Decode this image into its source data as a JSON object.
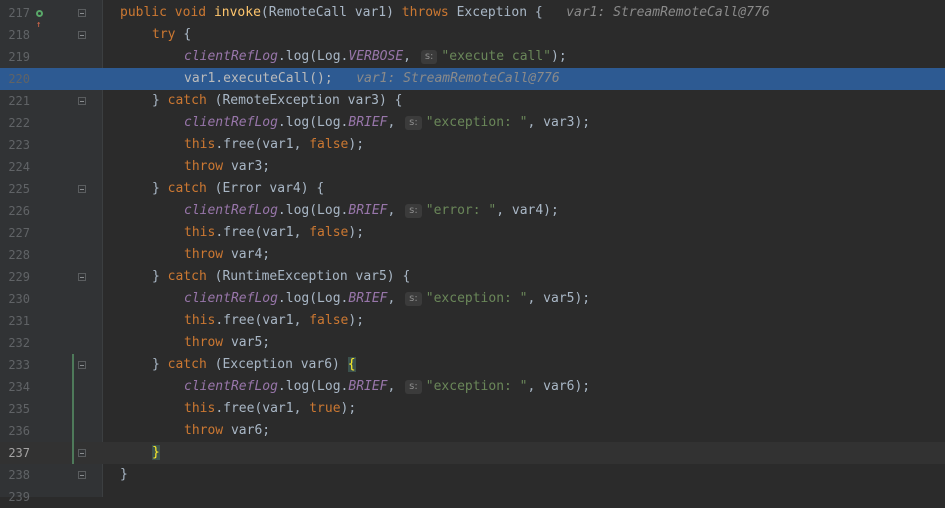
{
  "editor": {
    "lines": [
      {
        "num": "217",
        "tokens": [
          {
            "t": "public ",
            "c": "kw"
          },
          {
            "t": "void ",
            "c": "kw"
          },
          {
            "t": "invoke",
            "c": "fn"
          },
          {
            "t": "(RemoteCall var1) ",
            "c": "plain"
          },
          {
            "t": "throws ",
            "c": "kw"
          },
          {
            "t": "Exception {",
            "c": "plain"
          },
          {
            "t": "   var1: StreamRemoteCall@776",
            "c": "cmt"
          }
        ],
        "indent": 0
      },
      {
        "num": "218",
        "tokens": [
          {
            "t": "try ",
            "c": "kw"
          },
          {
            "t": "{",
            "c": "plain"
          }
        ],
        "indent": 1
      },
      {
        "num": "219",
        "tokens": [
          {
            "t": "clientRefLog",
            "c": "fld"
          },
          {
            "t": ".log(Log.",
            "c": "plain"
          },
          {
            "t": "VERBOSE",
            "c": "fld"
          },
          {
            "t": ", ",
            "c": "plain"
          },
          {
            "hint": "s:"
          },
          {
            "t": "\"execute call\"",
            "c": "str"
          },
          {
            "t": ");",
            "c": "plain"
          }
        ],
        "indent": 2
      },
      {
        "num": "220",
        "tokens": [
          {
            "t": "var1.executeCall();",
            "c": "plain"
          },
          {
            "t": "   var1: StreamRemoteCall@776",
            "c": "cmt"
          }
        ],
        "indent": 2,
        "exec": true
      },
      {
        "num": "221",
        "tokens": [
          {
            "t": "} ",
            "c": "plain"
          },
          {
            "t": "catch ",
            "c": "kw"
          },
          {
            "t": "(RemoteException var3) {",
            "c": "plain"
          }
        ],
        "indent": 1
      },
      {
        "num": "222",
        "tokens": [
          {
            "t": "clientRefLog",
            "c": "fld"
          },
          {
            "t": ".log(Log.",
            "c": "plain"
          },
          {
            "t": "BRIEF",
            "c": "fld"
          },
          {
            "t": ", ",
            "c": "plain"
          },
          {
            "hint": "s:"
          },
          {
            "t": "\"exception: \"",
            "c": "str"
          },
          {
            "t": ", var3);",
            "c": "plain"
          }
        ],
        "indent": 2
      },
      {
        "num": "223",
        "tokens": [
          {
            "t": "this",
            "c": "kw"
          },
          {
            "t": ".free(var1, ",
            "c": "plain"
          },
          {
            "t": "false",
            "c": "kw"
          },
          {
            "t": ");",
            "c": "plain"
          }
        ],
        "indent": 2
      },
      {
        "num": "224",
        "tokens": [
          {
            "t": "throw ",
            "c": "kw"
          },
          {
            "t": "var3;",
            "c": "plain"
          }
        ],
        "indent": 2
      },
      {
        "num": "225",
        "tokens": [
          {
            "t": "} ",
            "c": "plain"
          },
          {
            "t": "catch ",
            "c": "kw"
          },
          {
            "t": "(Error var4) {",
            "c": "plain"
          }
        ],
        "indent": 1
      },
      {
        "num": "226",
        "tokens": [
          {
            "t": "clientRefLog",
            "c": "fld"
          },
          {
            "t": ".log(Log.",
            "c": "plain"
          },
          {
            "t": "BRIEF",
            "c": "fld"
          },
          {
            "t": ", ",
            "c": "plain"
          },
          {
            "hint": "s:"
          },
          {
            "t": "\"error: \"",
            "c": "str"
          },
          {
            "t": ", var4);",
            "c": "plain"
          }
        ],
        "indent": 2
      },
      {
        "num": "227",
        "tokens": [
          {
            "t": "this",
            "c": "kw"
          },
          {
            "t": ".free(var1, ",
            "c": "plain"
          },
          {
            "t": "false",
            "c": "kw"
          },
          {
            "t": ");",
            "c": "plain"
          }
        ],
        "indent": 2
      },
      {
        "num": "228",
        "tokens": [
          {
            "t": "throw ",
            "c": "kw"
          },
          {
            "t": "var4;",
            "c": "plain"
          }
        ],
        "indent": 2
      },
      {
        "num": "229",
        "tokens": [
          {
            "t": "} ",
            "c": "plain"
          },
          {
            "t": "catch ",
            "c": "kw"
          },
          {
            "t": "(RuntimeException var5) {",
            "c": "plain"
          }
        ],
        "indent": 1
      },
      {
        "num": "230",
        "tokens": [
          {
            "t": "clientRefLog",
            "c": "fld"
          },
          {
            "t": ".log(Log.",
            "c": "plain"
          },
          {
            "t": "BRIEF",
            "c": "fld"
          },
          {
            "t": ", ",
            "c": "plain"
          },
          {
            "hint": "s:"
          },
          {
            "t": "\"exception: \"",
            "c": "str"
          },
          {
            "t": ", var5);",
            "c": "plain"
          }
        ],
        "indent": 2
      },
      {
        "num": "231",
        "tokens": [
          {
            "t": "this",
            "c": "kw"
          },
          {
            "t": ".free(var1, ",
            "c": "plain"
          },
          {
            "t": "false",
            "c": "kw"
          },
          {
            "t": ");",
            "c": "plain"
          }
        ],
        "indent": 2
      },
      {
        "num": "232",
        "tokens": [
          {
            "t": "throw ",
            "c": "kw"
          },
          {
            "t": "var5;",
            "c": "plain"
          }
        ],
        "indent": 2
      },
      {
        "num": "233",
        "tokens": [
          {
            "t": "} ",
            "c": "plain"
          },
          {
            "t": "catch ",
            "c": "kw"
          },
          {
            "t": "(Exception var6) ",
            "c": "plain"
          },
          {
            "t": "{",
            "c": "brace"
          }
        ],
        "indent": 1
      },
      {
        "num": "234",
        "tokens": [
          {
            "t": "clientRefLog",
            "c": "fld"
          },
          {
            "t": ".log(Log.",
            "c": "plain"
          },
          {
            "t": "BRIEF",
            "c": "fld"
          },
          {
            "t": ", ",
            "c": "plain"
          },
          {
            "hint": "s:"
          },
          {
            "t": "\"exception: \"",
            "c": "str"
          },
          {
            "t": ", var6);",
            "c": "plain"
          }
        ],
        "indent": 2
      },
      {
        "num": "235",
        "tokens": [
          {
            "t": "this",
            "c": "kw"
          },
          {
            "t": ".free(var1, ",
            "c": "plain"
          },
          {
            "t": "true",
            "c": "kw"
          },
          {
            "t": ");",
            "c": "plain"
          }
        ],
        "indent": 2
      },
      {
        "num": "236",
        "tokens": [
          {
            "t": "throw ",
            "c": "kw"
          },
          {
            "t": "var6;",
            "c": "plain"
          }
        ],
        "indent": 2
      },
      {
        "num": "237",
        "tokens": [
          {
            "t": "}",
            "c": "brace"
          }
        ],
        "indent": 1,
        "caret": true
      },
      {
        "num": "238",
        "tokens": [
          {
            "t": "}",
            "c": "plain"
          }
        ],
        "indent": 0
      },
      {
        "num": "239",
        "tokens": [],
        "indent": 0
      }
    ]
  },
  "colors": {
    "background": "#2b2b2b",
    "gutter": "#313335",
    "execution_line": "#2d5a92",
    "keyword": "#cc7832",
    "method": "#ffc66d",
    "field": "#9876aa",
    "string": "#6a8759"
  },
  "icons": {
    "line_217": "implements-method-icon"
  }
}
